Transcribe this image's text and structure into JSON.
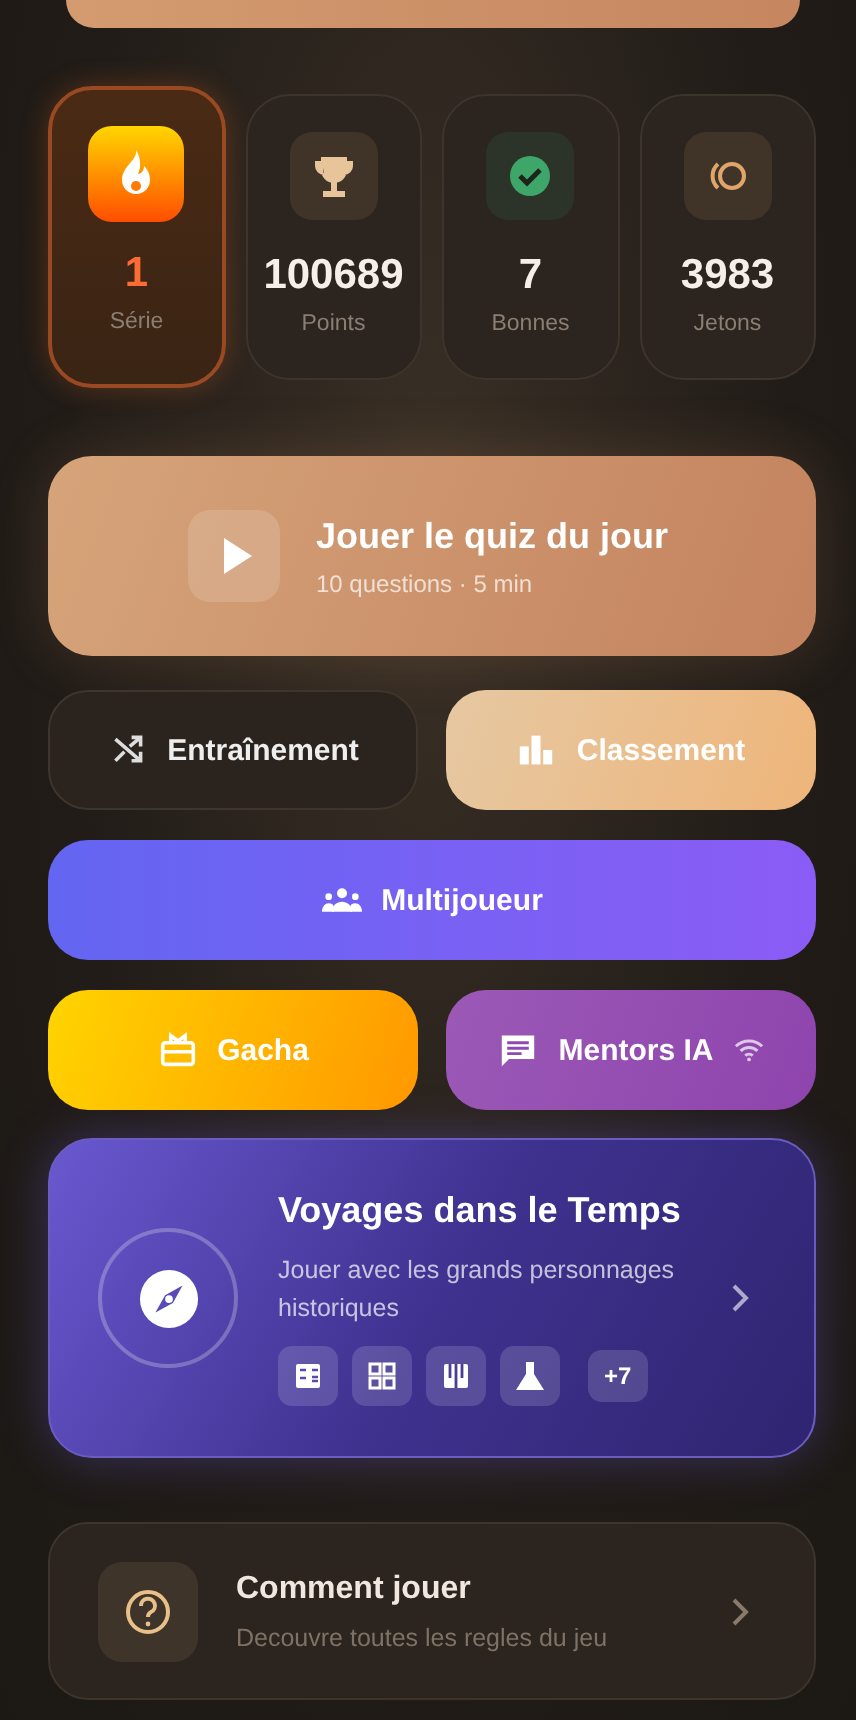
{
  "stats": [
    {
      "kind": "streak",
      "value": "1",
      "label": "Série"
    },
    {
      "kind": "points",
      "value": "100689",
      "label": "Points"
    },
    {
      "kind": "correct",
      "value": "7",
      "label": "Bonnes"
    },
    {
      "kind": "tokens",
      "value": "3983",
      "label": "Jetons"
    }
  ],
  "daily_quiz": {
    "title": "Jouer le quiz du jour",
    "subtitle": "10 questions · 5 min"
  },
  "actions": [
    {
      "kind": "practice",
      "label": "Entraînement"
    },
    {
      "kind": "leaderboard",
      "label": "Classement"
    },
    {
      "kind": "multiplayer",
      "label": "Multijoueur"
    },
    {
      "kind": "gacha",
      "label": "Gacha"
    },
    {
      "kind": "mentors",
      "label": "Mentors IA"
    }
  ],
  "time_travel": {
    "title": "Voyages dans le Temps",
    "description": "Jouer avec les grands personnages historiques",
    "topics": [
      {
        "kind": "calculator"
      },
      {
        "kind": "grid"
      },
      {
        "kind": "piano"
      },
      {
        "kind": "flask"
      }
    ],
    "more": "+7"
  },
  "how_to_play": {
    "title": "Comment jouer",
    "subtitle": "Decouvre toutes les regles du jeu"
  }
}
